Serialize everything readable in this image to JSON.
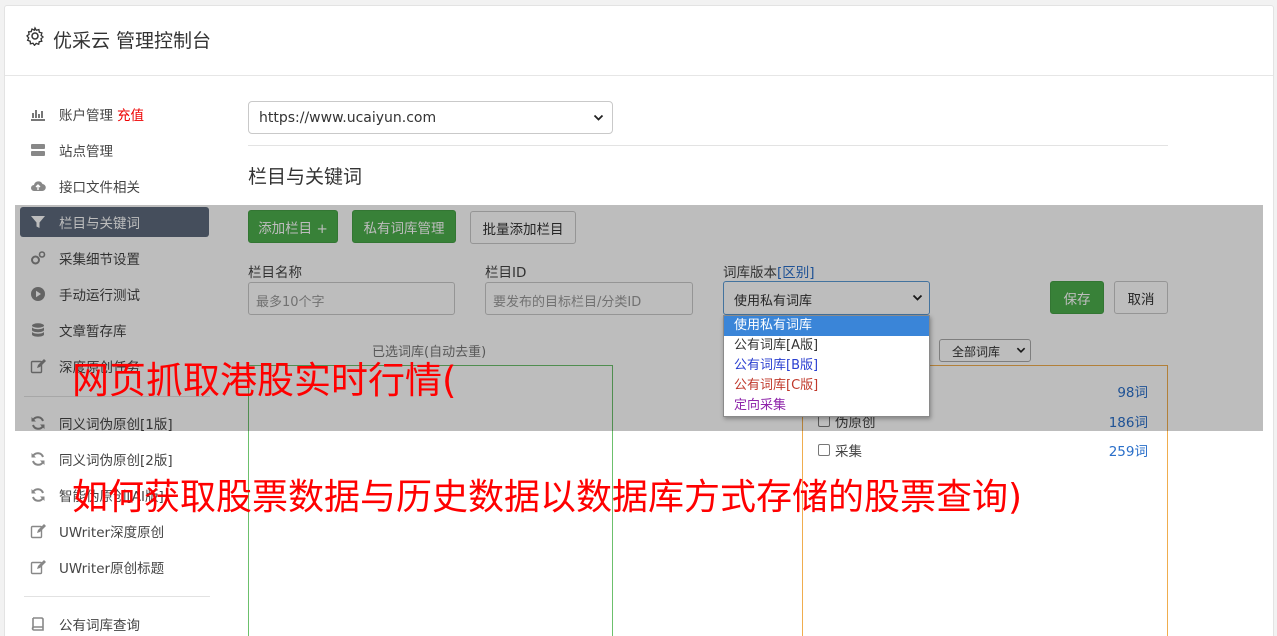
{
  "app": {
    "title": "优采云 管理控制台",
    "icon": "gear-icon"
  },
  "sidebar": {
    "items": [
      {
        "label": "账户管理",
        "extra": "充值",
        "icon": "bar-chart-icon"
      },
      {
        "label": "站点管理",
        "icon": "server-icon"
      },
      {
        "label": "接口文件相关",
        "icon": "cloud-upload-icon"
      },
      {
        "label": "栏目与关键词",
        "icon": "filter-icon",
        "active": true
      },
      {
        "label": "采集细节设置",
        "icon": "cogs-icon"
      },
      {
        "label": "手动运行测试",
        "icon": "play-circle-icon"
      },
      {
        "label": "文章暂存库",
        "icon": "database-icon"
      },
      {
        "label": "深度原创任务",
        "icon": "edit-icon"
      },
      {
        "label": "同义词伪原创[1版]",
        "icon": "refresh-icon"
      },
      {
        "label": "同义词伪原创[2版]",
        "icon": "refresh-icon"
      },
      {
        "label": "智能伪原创[AI版]",
        "icon": "refresh-icon"
      },
      {
        "label": "UWriter深度原创",
        "icon": "edit-icon"
      },
      {
        "label": "UWriter原创标题",
        "icon": "edit-icon"
      },
      {
        "label": "公有词库查询",
        "icon": "book-icon"
      }
    ]
  },
  "main": {
    "site_select": "https://www.ucaiyun.com",
    "section_title": "栏目与关键词",
    "buttons": {
      "add_column": "添加栏目 +",
      "private_lib": "私有词库管理",
      "batch_add": "批量添加栏目",
      "save": "保存",
      "cancel": "取消"
    },
    "form": {
      "name_label": "栏目名称",
      "name_placeholder": "最多10个字",
      "id_label": "栏目ID",
      "id_placeholder": "要发布的目标栏目/分类ID",
      "version_label": "词库版本",
      "version_link": "[区别]",
      "version_selected": "使用私有词库"
    },
    "dropdown": {
      "options": [
        {
          "label": "使用私有词库",
          "color": "#ffffff",
          "selected": true
        },
        {
          "label": "公有词库[A版]",
          "color": "#333333"
        },
        {
          "label": "公有词库[B版]",
          "color": "#2a3fd0"
        },
        {
          "label": "公有词库[C版]",
          "color": "#c0392b"
        },
        {
          "label": "定向采集",
          "color": "#8e24aa"
        }
      ]
    },
    "panel_caption": "已选词库(自动去重)",
    "filter_select": "全部词库",
    "libraries": [
      {
        "label": "",
        "count": "98词"
      },
      {
        "label": "伪原创",
        "count": "186词"
      },
      {
        "label": "采集",
        "count": "259词"
      }
    ]
  },
  "overlay_text": {
    "line1": "网页抓取港股实时行情(",
    "line2": "如何获取股票数据与历史数据以数据库方式存储的股票查询)"
  }
}
